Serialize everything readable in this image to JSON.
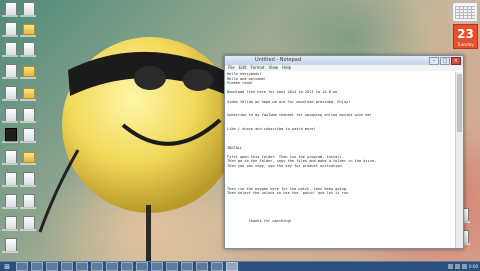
{
  "notepad": {
    "title": "Untitled - Notepad",
    "menus": [
      "File",
      "Edit",
      "Format",
      "View",
      "Help"
    ],
    "text_lines": [
      "Hello everybody!",
      "Hello and welcome!",
      "Please read!",
      "",
      "Download free here for Sony 2014 to 2013 to 15.0 we",
      "",
      "Video follow on hope we are for download provided. Enjoy!",
      "",
      "",
      "Subscribe to my YouTube channel for upcoming online movies with me!",
      "",
      "",
      "Like / share and subscribe to watch more!",
      "",
      "",
      "",
      "INSTALL",
      "",
      "First open this folder. Then run the program, install.",
      "Then go to the folder, copy the files and make a folder in the drive.",
      "Then you can copy, use the key for product activation.",
      "",
      "",
      "",
      "",
      "Then run the keygen here for the patch, then keep going.",
      "Then select the unlock to use the 'patch' and let it run.",
      "",
      "",
      "",
      "",
      "",
      "          thanks for watching!",
      "",
      "",
      "",
      "",
      "",
      "",
      "",
      "",
      "        Have fun!!!"
    ]
  },
  "calendar": {
    "day": "23",
    "month": "Tuesday"
  },
  "taskbar": {
    "start_glyph": "⊞",
    "clock_time": "0:00",
    "clock_date": "1/1/2014"
  },
  "desktop_icons": [
    {
      "name": "desktop-icon-1",
      "kind": "doc"
    },
    {
      "name": "desktop-icon-2",
      "kind": "doc"
    },
    {
      "name": "desktop-icon-3",
      "kind": "doc"
    },
    {
      "name": "desktop-icon-4",
      "kind": "folder"
    },
    {
      "name": "desktop-icon-5",
      "kind": "doc"
    },
    {
      "name": "desktop-icon-6",
      "kind": "doc"
    },
    {
      "name": "desktop-icon-7",
      "kind": "dark"
    },
    {
      "name": "desktop-icon-8",
      "kind": "doc"
    },
    {
      "name": "desktop-icon-9",
      "kind": "doc"
    },
    {
      "name": "desktop-icon-10",
      "kind": "folder"
    },
    {
      "name": "desktop-icon-11",
      "kind": "doc"
    },
    {
      "name": "desktop-icon-12",
      "kind": "doc"
    }
  ]
}
